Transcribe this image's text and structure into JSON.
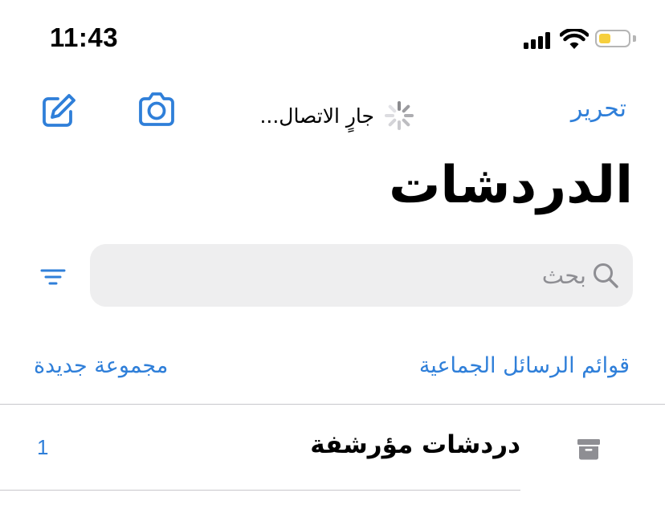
{
  "status_bar": {
    "time": "11:43",
    "battery_level": 0.4
  },
  "nav": {
    "connecting_label": "جارٍ الاتصال...",
    "edit_label": "تحرير"
  },
  "header": {
    "title": "الدردشات"
  },
  "search": {
    "placeholder": "بحث"
  },
  "links": {
    "broadcast_lists": "قوائم الرسائل الجماعية",
    "new_group": "مجموعة جديدة"
  },
  "archived": {
    "label": "دردشات مؤرشفة",
    "count": "1"
  },
  "icons": {
    "compose": "compose-icon",
    "camera": "camera-icon",
    "spinner": "loading-spinner-icon",
    "filter": "filter-icon",
    "search": "search-icon",
    "archive": "archive-box-icon"
  },
  "colors": {
    "accent": "#2f7fd9",
    "search_bg": "#eeeeef",
    "divider": "#c8c7cc",
    "placeholder": "#8e8e93",
    "battery_fill": "#f6cf3d"
  }
}
